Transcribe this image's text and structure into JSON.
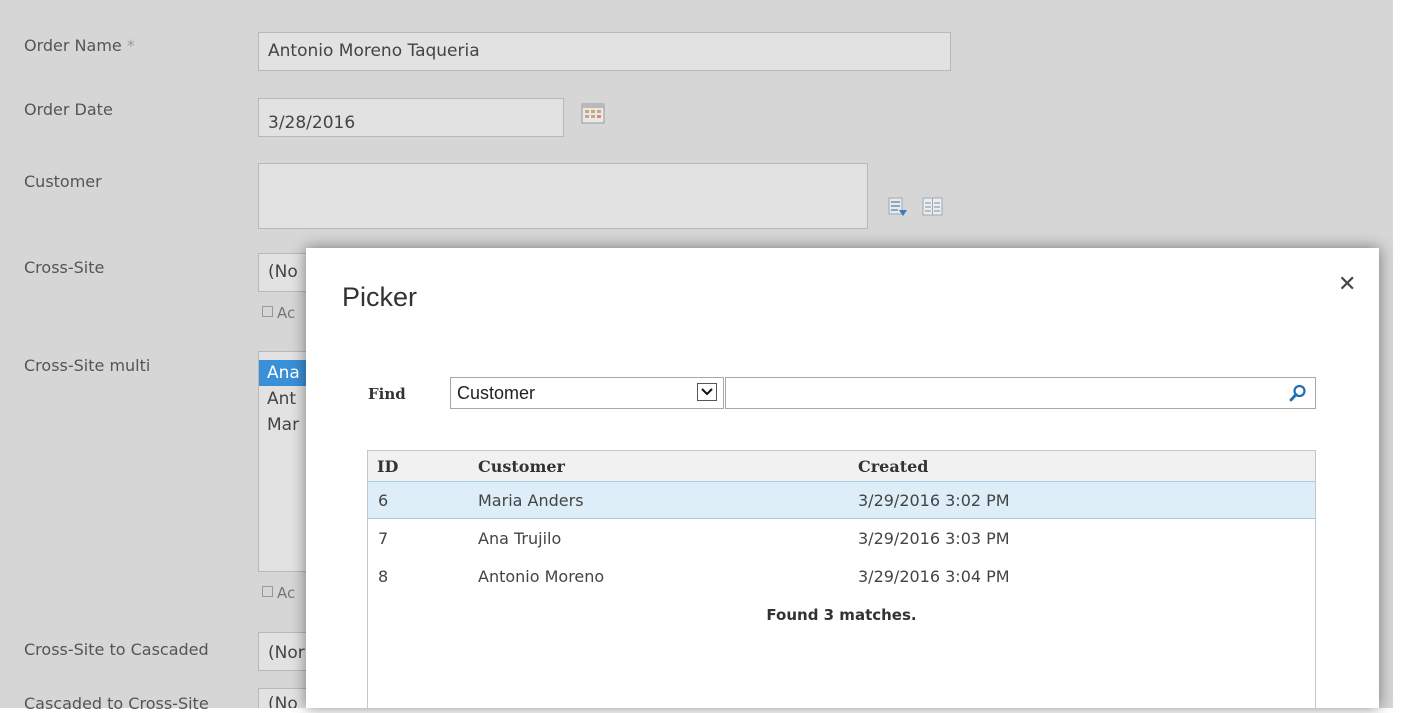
{
  "form": {
    "order_name_label": "Order Name",
    "required_marker": "*",
    "order_name_value": "Antonio Moreno Taqueria",
    "order_date_label": "Order Date",
    "order_date_value": "3/28/2016",
    "customer_label": "Customer",
    "customer_value": "",
    "cross_site_label": "Cross-Site",
    "cross_site_value": "(No",
    "cross_site_add": "Ac",
    "cross_site_multi_label": "Cross-Site multi",
    "cross_site_multi_items": [
      "Ana",
      "Ant",
      "Mar"
    ],
    "cross_site_multi_add": "Ac",
    "cross_site_to_cascaded_label": "Cross-Site to Cascaded",
    "cross_site_to_cascaded_value": "(Nor",
    "cascaded_to_cross_site_label": "Cascaded to Cross-Site",
    "cascaded_to_cross_site_value": "(No"
  },
  "picker": {
    "title": "Picker",
    "close": "✕",
    "find_label": "Find",
    "find_field": "Customer",
    "search_value": "",
    "columns": [
      "ID",
      "Customer",
      "Created"
    ],
    "rows": [
      {
        "id": "6",
        "customer": "Maria Anders",
        "created": "3/29/2016 3:02 PM",
        "selected": true
      },
      {
        "id": "7",
        "customer": "Ana Trujilo",
        "created": "3/29/2016 3:03 PM",
        "selected": false
      },
      {
        "id": "8",
        "customer": "Antonio Moreno",
        "created": "3/29/2016 3:04 PM",
        "selected": false
      }
    ],
    "status": "Found 3 matches."
  },
  "icons": {
    "calendar": "calendar-icon",
    "browse": "address-book-icon",
    "check_names": "check-names-icon",
    "dropdown": "chevron-down-icon",
    "search": "search-icon",
    "close": "close-icon"
  },
  "colors": {
    "backdrop": "#d6d6d6",
    "selected_row": "#ddeef8",
    "search_icon": "#1e6fb4"
  }
}
